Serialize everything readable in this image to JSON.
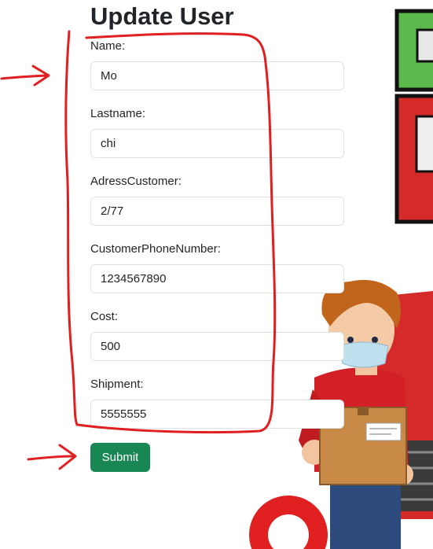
{
  "form": {
    "title": "Update User",
    "fields": [
      {
        "label": "Name:",
        "value": "Mo"
      },
      {
        "label": "Lastname:",
        "value": "chi"
      },
      {
        "label": "AdressCustomer:",
        "value": "2/77"
      },
      {
        "label": "CustomerPhoneNumber:",
        "value": "1234567890"
      },
      {
        "label": "Cost:",
        "value": "500"
      },
      {
        "label": "Shipment:",
        "value": "5555555"
      }
    ],
    "submit_label": "Submit"
  },
  "colors": {
    "submit_bg": "#198754",
    "annotation": "#e02020",
    "shirt": "#d32027",
    "box": "#c98a48"
  },
  "icons": [
    "annotation-arrow-icon",
    "delivery-man-illustration"
  ]
}
